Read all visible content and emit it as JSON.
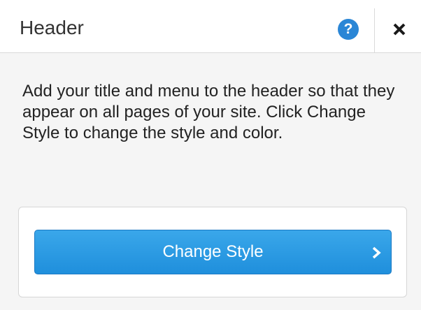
{
  "panel": {
    "title": "Header",
    "help_glyph": "?",
    "description": "Add your title and menu to the header so that they appear on all pages of your site. Click Change Style to change the style and color."
  },
  "change_style": {
    "label": "Change Style"
  },
  "icons": {
    "help": "help-icon",
    "close": "close-icon",
    "chevron": "chevron-right-icon"
  },
  "colors": {
    "accent_blue": "#2a86d6",
    "button_blue": "#1f8fdc",
    "text": "#222222"
  }
}
